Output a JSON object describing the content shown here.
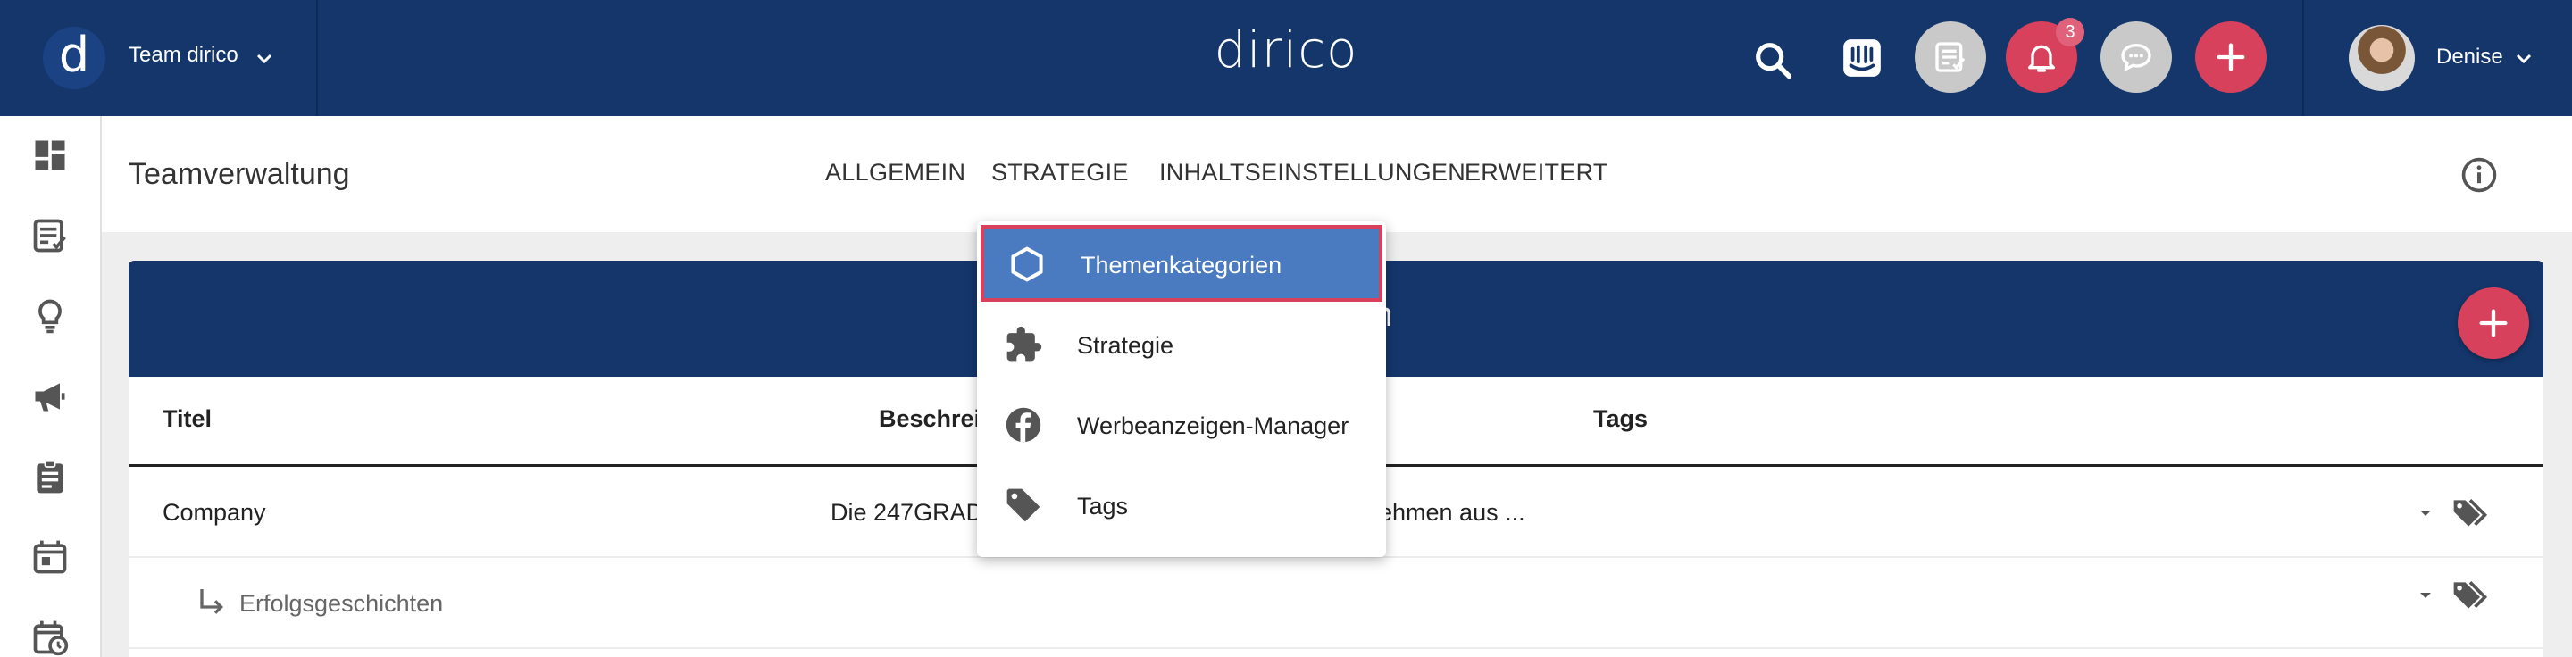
{
  "topbar": {
    "team_logo": "d",
    "team_name": "Team dirico",
    "brand": "dirico",
    "notification_count": "3",
    "user_name": "Denise"
  },
  "header": {
    "title": "Teamverwaltung",
    "tabs": [
      "ALLGEMEIN",
      "STRATEGIE",
      "INHALTSEINSTELLUNGEN",
      "ERWEITERT"
    ]
  },
  "card": {
    "title_fragment": "egorien",
    "columns": {
      "title": "Titel",
      "description": "Beschrei",
      "tags": "Tags"
    },
    "rows": [
      {
        "title": "Company",
        "description_start": "Die 247GRAD",
        "description_end": "ehmen aus ..."
      },
      {
        "title": "Erfolgsgeschichten"
      }
    ]
  },
  "dropdown": {
    "items": [
      {
        "label": "Themenkategorien",
        "icon": "hexagon-icon",
        "active": true
      },
      {
        "label": "Strategie",
        "icon": "puzzle-icon"
      },
      {
        "label": "Werbeanzeigen-Manager",
        "icon": "facebook-icon"
      },
      {
        "label": "Tags",
        "icon": "tag-icon"
      }
    ]
  },
  "colors": {
    "topbar": "#14366b",
    "accent": "#d7415b",
    "active_item": "#4a7bc1"
  }
}
